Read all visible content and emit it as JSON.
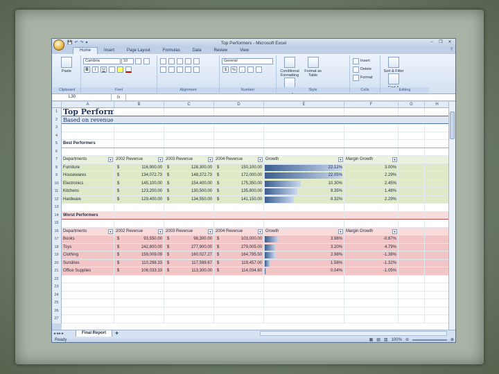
{
  "window": {
    "title": "Top Performers - Microsoft Excel",
    "qat": [
      "💾",
      "↶",
      "↷",
      "▾"
    ],
    "controls": [
      "–",
      "❐",
      "✕"
    ]
  },
  "ribbon_tabs": [
    "Home",
    "Insert",
    "Page Layout",
    "Formulas",
    "Data",
    "Review",
    "View"
  ],
  "ribbon": {
    "clipboard": {
      "paste": "Paste",
      "name": "Clipboard"
    },
    "font": {
      "family": "Cambria",
      "size": "10",
      "name": "Font"
    },
    "alignment": {
      "name": "Alignment"
    },
    "number": {
      "format": "General",
      "currency": "$",
      "percent": "%",
      "comma": ",",
      "name": "Number"
    },
    "styles": {
      "conditional": "Conditional Formatting",
      "format_table": "Format as Table",
      "cell_styles": "Cell Styles",
      "name": "Style"
    },
    "cells": {
      "insert": "Insert",
      "delete": "Delete",
      "format": "Format",
      "name": "Cells"
    },
    "editing": {
      "sort": "Sort & Filter",
      "find": "Find & Select",
      "name": "Editing"
    }
  },
  "formula_bar": {
    "name_box": "L30",
    "fx": "fx",
    "value": ""
  },
  "columns": [
    "A",
    "B",
    "C",
    "D",
    "E",
    "F",
    "G",
    "H"
  ],
  "sheet": {
    "title": "Top Performing Categories",
    "subtitle": "Based on revenue and margin growth",
    "best_label": "Best Performers",
    "worst_label": "Worst Performers",
    "headers": [
      "Departments",
      "2002 Revenue",
      "2003 Revenue",
      "2004 Revenue",
      "Growth",
      "Margin Growth"
    ],
    "best": [
      {
        "dept": "Furniture",
        "r2002": "116,900.00",
        "r2003": "128,300.00",
        "r2004": "150,100.00",
        "growth": "22.12%",
        "margin": "3.00%",
        "g": 0.2212
      },
      {
        "dept": "Housewares",
        "r2002": "134,072.73",
        "r2003": "148,372.73",
        "r2004": "172,000.00",
        "growth": "22.05%",
        "margin": "2.29%",
        "g": 0.2205
      },
      {
        "dept": "Electronics",
        "r2002": "145,100.00",
        "r2003": "154,400.00",
        "r2004": "175,350.00",
        "growth": "10.30%",
        "margin": "2.45%",
        "g": 0.103
      },
      {
        "dept": "Kitchens",
        "r2002": "123,200.00",
        "r2003": "130,500.00",
        "r2004": "135,800.00",
        "growth": "9.35%",
        "margin": "1.48%",
        "g": 0.0935
      },
      {
        "dept": "Hardware",
        "r2002": "129,400.00",
        "r2003": "134,550.00",
        "r2004": "141,150.00",
        "growth": "8.32%",
        "margin": "2.29%",
        "g": 0.0832
      }
    ],
    "worst": [
      {
        "dept": "Books",
        "r2002": "93,550.00",
        "r2003": "98,300.00",
        "r2004": "103,000.00",
        "growth": "3.98%",
        "margin": "-0.87%",
        "g": 0.0398
      },
      {
        "dept": "Toys",
        "r2002": "242,800.00",
        "r2003": "277,900.00",
        "r2004": "279,005.00",
        "growth": "3.20%",
        "margin": "4.79%",
        "g": 0.032
      },
      {
        "dept": "Clothing",
        "r2002": "159,009.09",
        "r2003": "160,027.27",
        "r2004": "164,795.50",
        "growth": "2.98%",
        "margin": "-1.38%",
        "g": 0.0298
      },
      {
        "dept": "Sundries",
        "r2002": "110,298.33",
        "r2003": "117,599.67",
        "r2004": "119,457.00",
        "growth": "1.58%",
        "margin": "-1.32%",
        "g": 0.0158
      },
      {
        "dept": "Office Supplies",
        "r2002": "106,033.33",
        "r2003": "113,300.00",
        "r2004": "114,034.60",
        "growth": "0.04%",
        "margin": "-1.05%",
        "g": 0.0004
      }
    ],
    "currency": "$"
  },
  "sheet_tabs": {
    "active": "Final Report"
  },
  "status": {
    "text": "Ready",
    "zoom": "100%"
  },
  "colors": {
    "best_fill": "#dde9c7",
    "worst_fill": "#f2c6c6",
    "header_best": "#eaf1dd",
    "header_worst": "#f7dada",
    "bar": "#3b5f8f"
  }
}
